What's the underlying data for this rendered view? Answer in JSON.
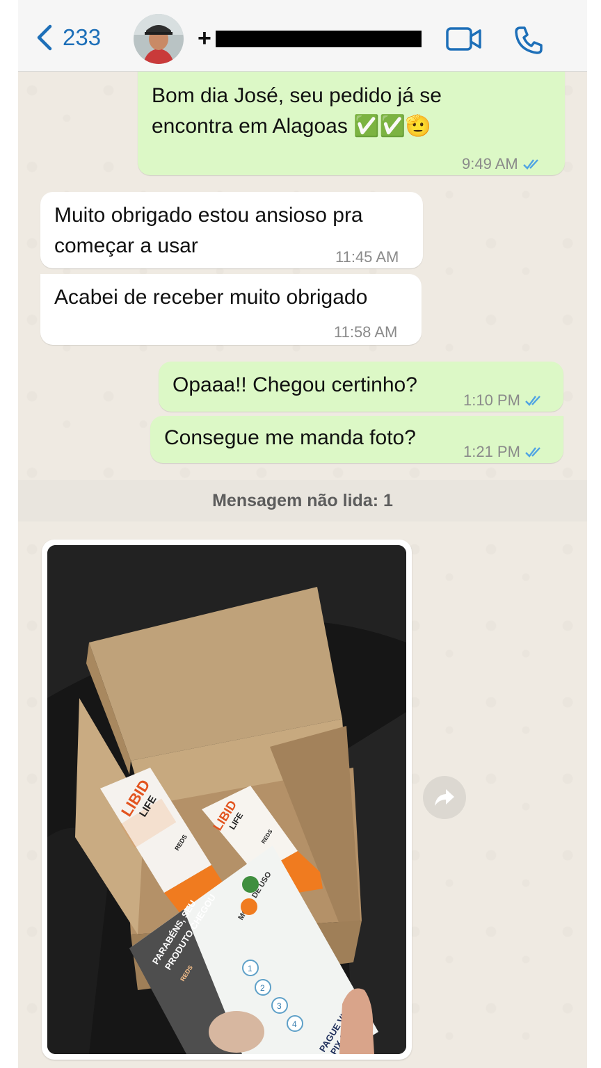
{
  "header": {
    "back_count": "233",
    "contact_prefix": "+"
  },
  "messages": [
    {
      "direction": "out",
      "line1": "Bom dia José, seu pedido já se",
      "line2": "encontra em Alagoas",
      "emoji": "✅✅🫡",
      "time": "9:49 AM",
      "status": "read"
    },
    {
      "direction": "in",
      "line1": "Muito obrigado estou ansioso pra",
      "line2": "começar a usar",
      "time": "11:45 AM"
    },
    {
      "direction": "in",
      "text": "Acabei de receber muito obrigado",
      "time": "11:58 AM"
    },
    {
      "direction": "out",
      "text": "Opaaa!! Chegou certinho?",
      "time": "1:10 PM",
      "status": "read"
    },
    {
      "direction": "out",
      "text": "Consegue me manda foto?",
      "time": "1:21 PM",
      "status": "read"
    }
  ],
  "unread_banner": "Mensagem não lida: 1",
  "photo": {
    "tube_brand_1": "LIBID",
    "tube_brand_2": "LIFE",
    "tube_maker": "REDS",
    "leaflet_title_1": "PARABÉNS, SEU",
    "leaflet_title_2": "PRODUTO CHEGOU",
    "leaflet_section": "MODO DE USO",
    "leaflet_brand": "REDS",
    "leaflet_footer_1": "PAGUE VIA",
    "leaflet_footer_2": "PIX CNP",
    "steps": [
      "1",
      "2",
      "3",
      "4"
    ]
  },
  "colors": {
    "outgoing_bubble": "#dcf8c6",
    "incoming_bubble": "#ffffff",
    "accent": "#1d6fb8",
    "read_ticks": "#4fa3e3",
    "tube_orange": "#f07b1f"
  }
}
